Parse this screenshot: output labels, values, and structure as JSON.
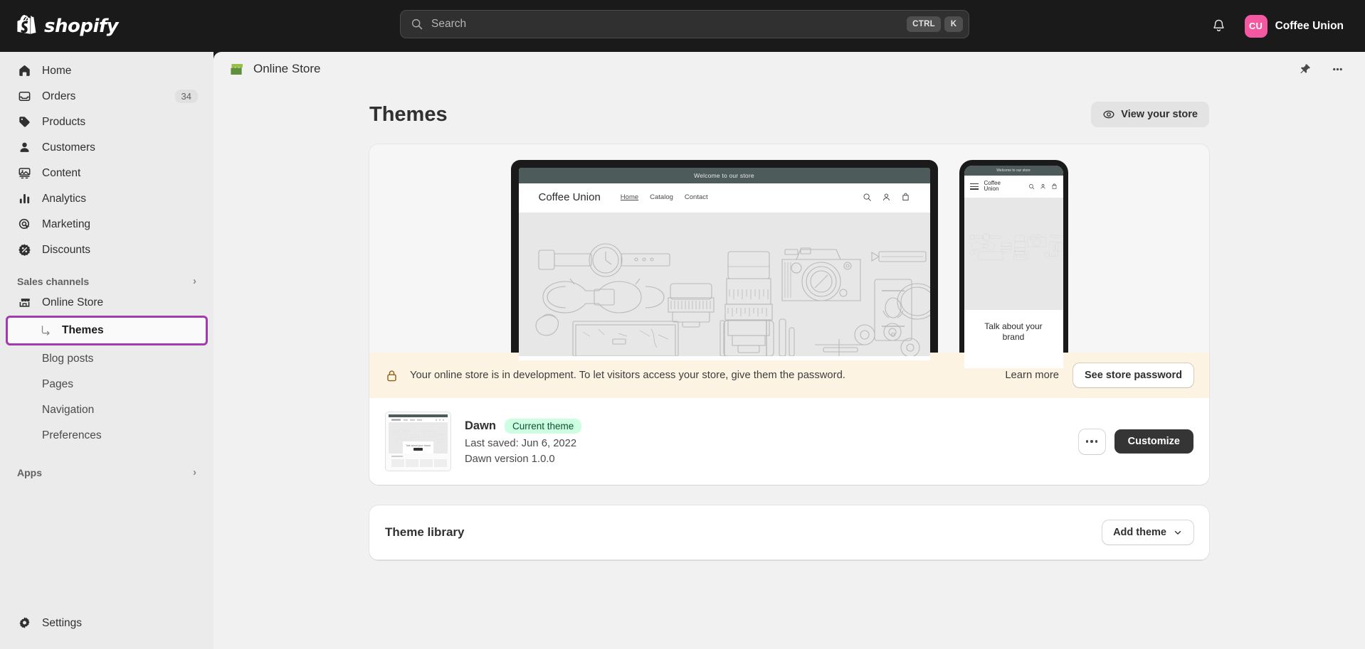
{
  "topbar": {
    "brand": "shopify",
    "search": {
      "placeholder": "Search",
      "key_ctrl": "CTRL",
      "key_k": "K"
    },
    "user": {
      "initials": "CU",
      "name": "Coffee Union"
    }
  },
  "sidebar": {
    "items": [
      {
        "label": "Home",
        "icon": "home-icon",
        "badge": ""
      },
      {
        "label": "Orders",
        "icon": "orders-icon",
        "badge": "34"
      },
      {
        "label": "Products",
        "icon": "products-tag-icon",
        "badge": ""
      },
      {
        "label": "Customers",
        "icon": "customers-person-icon",
        "badge": ""
      },
      {
        "label": "Content",
        "icon": "content-media-icon",
        "badge": ""
      },
      {
        "label": "Analytics",
        "icon": "analytics-bars-icon",
        "badge": ""
      },
      {
        "label": "Marketing",
        "icon": "marketing-target-icon",
        "badge": ""
      },
      {
        "label": "Discounts",
        "icon": "discounts-percent-icon",
        "badge": ""
      }
    ],
    "sales_channels": {
      "label": "Sales channels",
      "chevron": "›"
    },
    "online_store": {
      "label": "Online Store",
      "icon": "storefront-icon"
    },
    "sub_items": [
      {
        "label": "Themes",
        "selected": true
      },
      {
        "label": "Blog posts",
        "selected": false
      },
      {
        "label": "Pages",
        "selected": false
      },
      {
        "label": "Navigation",
        "selected": false
      },
      {
        "label": "Preferences",
        "selected": false
      }
    ],
    "apps": {
      "label": "Apps",
      "chevron": "›"
    },
    "settings": {
      "label": "Settings",
      "icon": "gear-icon"
    }
  },
  "main_header": {
    "breadcrumb": "Online Store",
    "pin_icon": "pin-icon",
    "more_icon": "more-horizontal-icon"
  },
  "page": {
    "title": "Themes",
    "view_store_button": "View your store"
  },
  "preview": {
    "announcement": "Welcome to our store",
    "store_brand": "Coffee Union",
    "nav_links": [
      "Home",
      "Catalog",
      "Contact"
    ],
    "mobile_brand_line1": "Coffee",
    "mobile_brand_line2": "Union",
    "mobile_heading": "Talk about your brand"
  },
  "dev_banner": {
    "message": "Your online store is in development. To let visitors access your store, give them the password.",
    "learn_more": "Learn more",
    "password_button": "See store password",
    "icon": "lock-icon",
    "background": "#fdf3e3"
  },
  "current_theme": {
    "name": "Dawn",
    "badge": "Current theme",
    "badge_color": "#cdfee1",
    "last_saved": "Last saved: Jun 6, 2022",
    "version": "Dawn version 1.0.0",
    "customize_button": "Customize",
    "thumbnail_caption": "Talk about your brand"
  },
  "theme_library": {
    "title": "Theme library",
    "add_theme_button": "Add theme",
    "chevron": "⌄"
  }
}
